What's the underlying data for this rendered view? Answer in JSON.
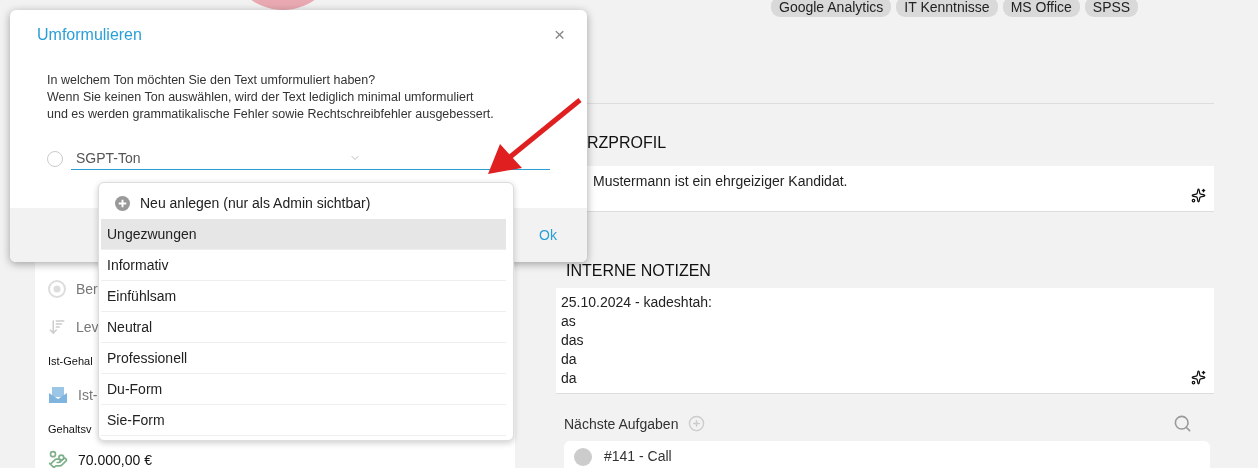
{
  "tags": [
    "Google Analytics",
    "IT Kenntnisse",
    "MS Office",
    "SPSS"
  ],
  "profile": {
    "heading": "RZPROFIL",
    "text": "Mustermann ist ein ehrgeiziger Kandidat."
  },
  "notes": {
    "heading": "INTERNE NOTIZEN",
    "lines": [
      "25.10.2024 - kadeshtah:",
      "as",
      "das",
      "da",
      "da"
    ]
  },
  "tasks": {
    "title": "Nächste Aufgaben",
    "first_task": "#141 - Call"
  },
  "left_panel": [
    {
      "kind": "radio",
      "text": "Ber"
    },
    {
      "kind": "sort",
      "text": "Lev"
    },
    {
      "kind": "label",
      "text": "Ist-Gehal"
    },
    {
      "kind": "envelope",
      "text": "Ist-"
    },
    {
      "kind": "label",
      "text": "Gehaltsv"
    },
    {
      "kind": "money",
      "text": "70.000,00 €"
    }
  ],
  "dialog": {
    "title": "Umformulieren",
    "close": "×",
    "lines": [
      "In welchem Ton möchten Sie den Text umformuliert haben?",
      "Wenn Sie keinen Ton auswählen, wird der Text lediglich minimal umformuliert",
      "und es werden grammatikalische Fehler sowie Rechtschreibfehler ausgebessert."
    ],
    "select": {
      "checked": false,
      "value": "SGPT-Ton"
    },
    "ok": "Ok"
  },
  "dropdown": {
    "create_item": "Neu anlegen (nur als Admin sichtbar)",
    "options": [
      {
        "label": "Ungezwungen",
        "selected": true
      },
      {
        "label": "Informativ",
        "selected": false
      },
      {
        "label": "Einfühlsam",
        "selected": false
      },
      {
        "label": "Neutral",
        "selected": false
      },
      {
        "label": "Professionell",
        "selected": false
      },
      {
        "label": "Du-Form",
        "selected": false
      },
      {
        "label": "Sie-Form",
        "selected": false
      }
    ]
  }
}
